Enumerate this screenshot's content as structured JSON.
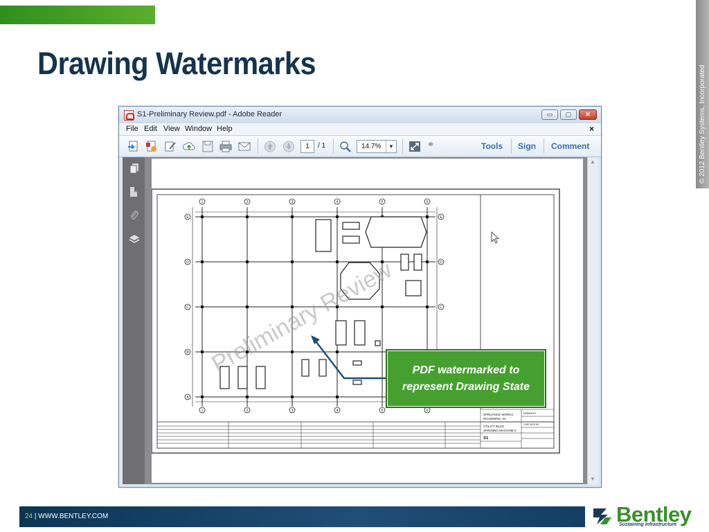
{
  "slide": {
    "title": "Drawing Watermarks",
    "copyright": "© 2012 Bentley Systems, Incorporated",
    "footer_page": "24",
    "footer_sep": " | ",
    "footer_url": "WWW.BENTLEY.COM",
    "logo_text": "Bentley",
    "logo_tagline": "Sustaining Infrastructure",
    "colors": {
      "accent_green": "#46a02f",
      "title_navy": "#14334f",
      "footer_blue": "#1f4e77"
    }
  },
  "reader": {
    "window_title": "S1-Preliminary Review.pdf - Adobe Reader",
    "window_buttons": {
      "minimize": "▭",
      "maximize": "▢",
      "close": "✕"
    },
    "menu": [
      "File",
      "Edit",
      "View",
      "Window",
      "Help"
    ],
    "menu_close": "×",
    "toolbar": {
      "page_value": "1",
      "page_total": "/ 1",
      "zoom_value": "14.7%",
      "tools_label": "Tools",
      "sign_label": "Sign",
      "comment_label": "Comment"
    }
  },
  "drawing": {
    "watermark": "Preliminary Review",
    "column_labels": [
      "1",
      "2",
      "3",
      "4",
      "5",
      "6"
    ],
    "row_labels": [
      "E",
      "D",
      "C",
      "B",
      "A"
    ],
    "title_block": {
      "project": "SPRUANCE WORKS",
      "location": "RICHMOND, VA",
      "subject": "UTILITY BLDG",
      "subject2": "SPINNING MACHINE II",
      "sheet": "S1",
      "drawn_by": "DRAWN BY",
      "checked_by": "CHECKED BY"
    }
  },
  "callout": {
    "line1": "PDF watermarked to",
    "line2": "represent Drawing State"
  }
}
